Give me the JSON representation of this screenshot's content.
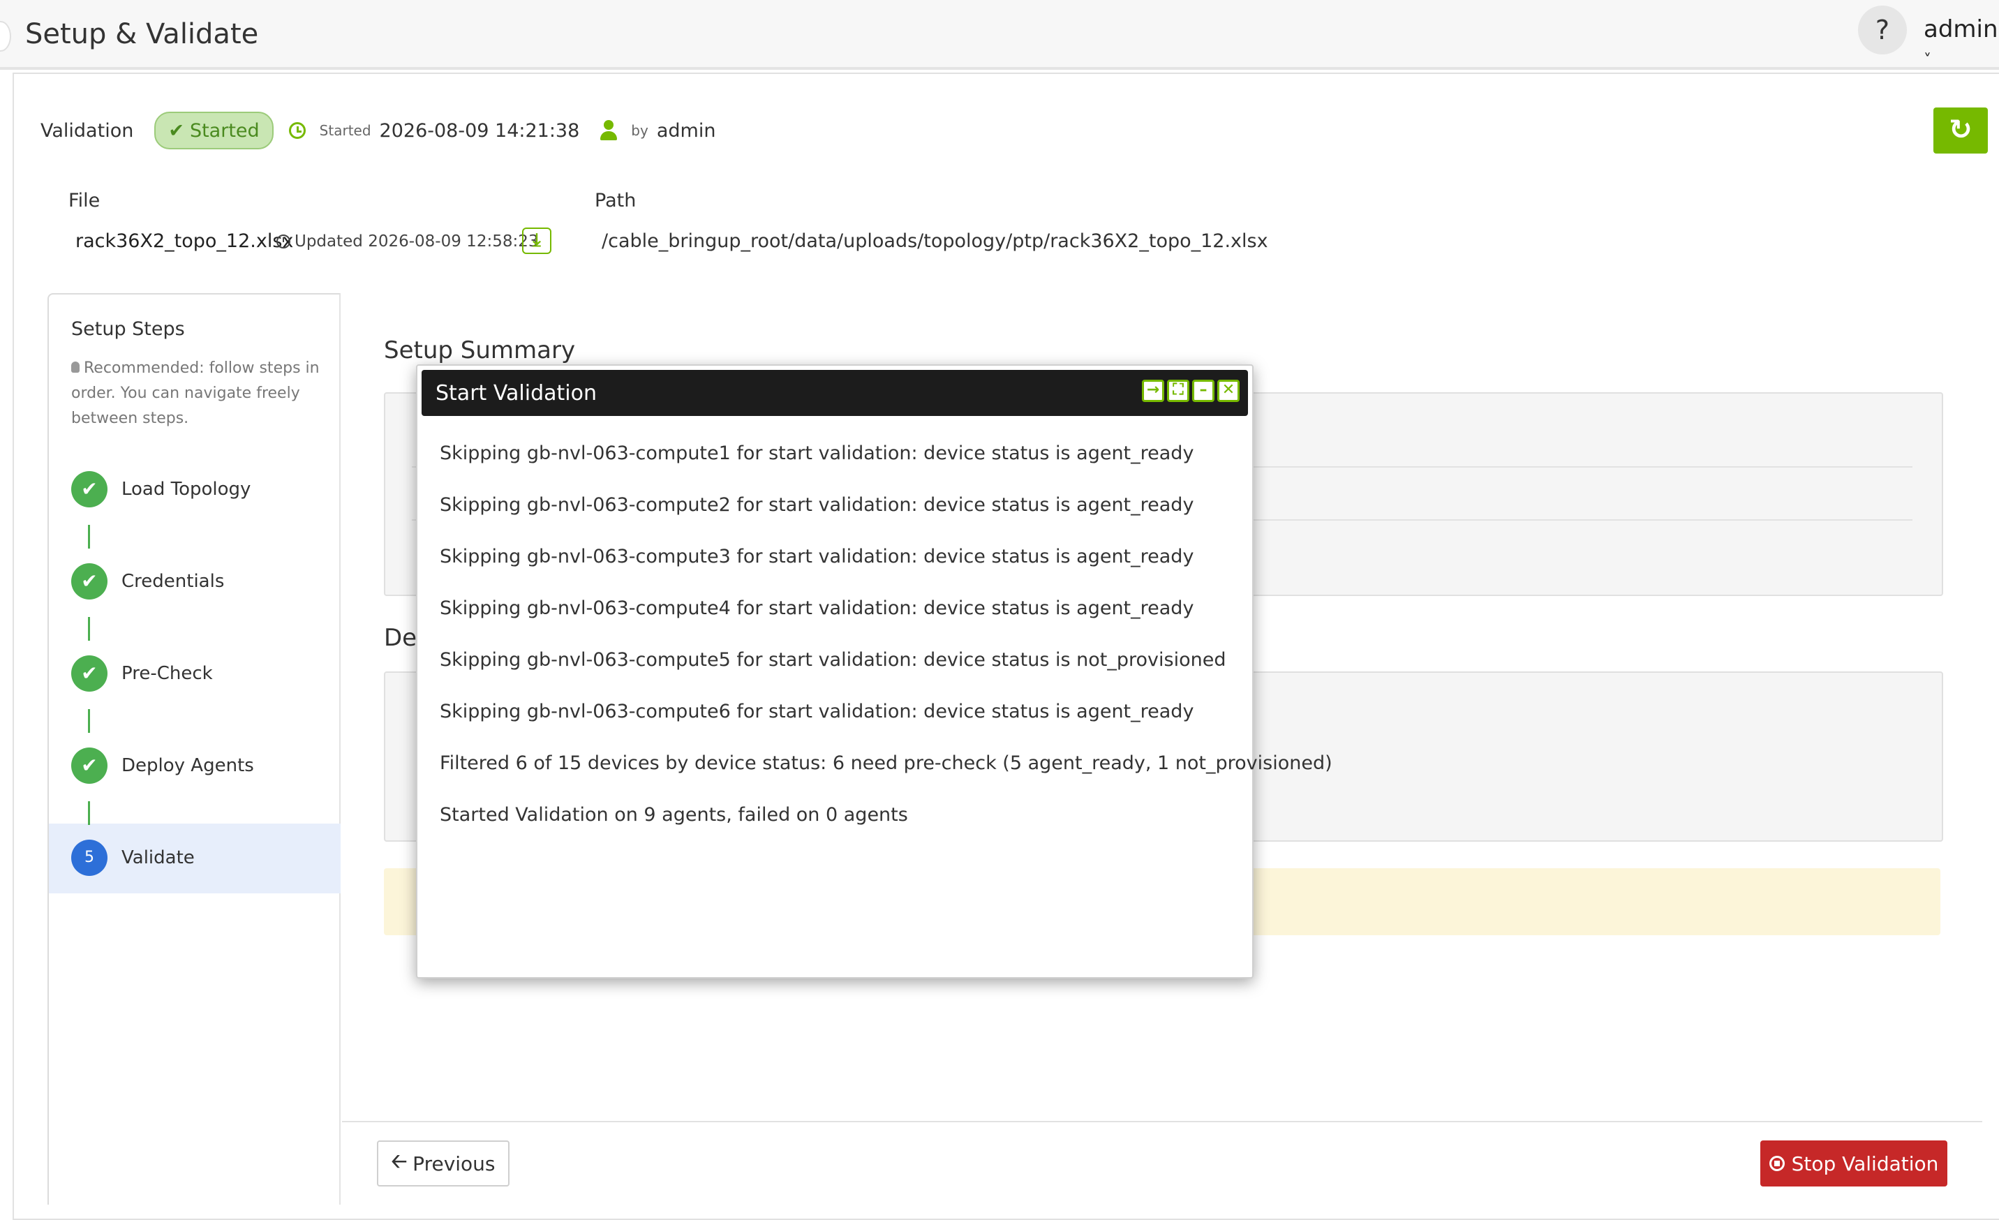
{
  "header": {
    "page_title": "Setup & Validate",
    "help_label": "?",
    "user_name": "admin",
    "user_caret": "˅"
  },
  "status": {
    "label": "Validation",
    "badge_check": "✔",
    "badge_text": "Started",
    "started_prefix": "Started",
    "started_time": "2026-08-09 14:21:38",
    "by_prefix": "by",
    "by_user": "admin",
    "refresh_icon": "↻"
  },
  "file": {
    "file_label": "File",
    "path_label": "Path",
    "name": "rack36X2_topo_12.xlsx",
    "updated": "Updated 2026-08-09 12:58:23",
    "download_icon": "⤓",
    "path": "/cable_bringup_root/data/uploads/topology/ptp/rack36X2_topo_12.xlsx"
  },
  "steps": {
    "title": "Setup Steps",
    "hint": "Recommended: follow steps in order. You can navigate freely between steps.",
    "items": [
      {
        "label": "Load Topology",
        "marker": "✔",
        "state": "done"
      },
      {
        "label": "Credentials",
        "marker": "✔",
        "state": "done"
      },
      {
        "label": "Pre-Check",
        "marker": "✔",
        "state": "done"
      },
      {
        "label": "Deploy Agents",
        "marker": "✔",
        "state": "done"
      },
      {
        "label": "Validate",
        "marker": "5",
        "state": "active"
      }
    ]
  },
  "main": {
    "summary_title": "Setup Summary",
    "devices_title_partial": "Dev"
  },
  "footer": {
    "previous_arrow": "🡠",
    "previous_label": "Previous",
    "stop_label": "Stop Validation"
  },
  "dialog": {
    "title": "Start Validation",
    "messages": [
      "Skipping gb-nvl-063-compute1 for start validation: device status is agent_ready",
      "Skipping gb-nvl-063-compute2 for start validation: device status is agent_ready",
      "Skipping gb-nvl-063-compute3 for start validation: device status is agent_ready",
      "Skipping gb-nvl-063-compute4 for start validation: device status is agent_ready",
      "Skipping gb-nvl-063-compute5 for start validation: device status is not_provisioned",
      "Skipping gb-nvl-063-compute6 for start validation: device status is agent_ready",
      "Filtered 6 of 15 devices by device status: 6 need pre-check (5 agent_ready, 1 not_provisioned)",
      "Started Validation on 9 agents, failed on 0 agents"
    ],
    "buttons": {
      "export": "→",
      "maximize": "⛶",
      "minimize": "–",
      "close": "✕"
    }
  },
  "colors": {
    "accent": "#76b900",
    "step_done": "#4caf50",
    "step_active": "#2d6fd8",
    "stop": "#c62828",
    "dialog_header": "#1c1c1c"
  }
}
